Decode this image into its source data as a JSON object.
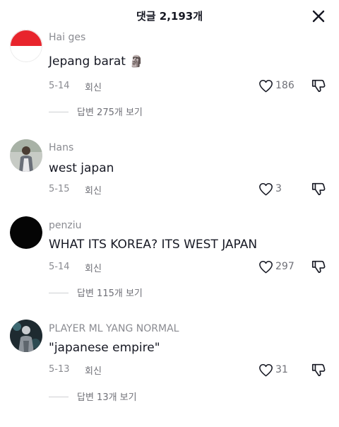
{
  "header": {
    "title": "댓글 2,193개"
  },
  "comments": [
    {
      "username": "Hai ges",
      "text": "Jepang barat",
      "emoji": "🗿",
      "date": "5-14",
      "reply_label": "회신",
      "likes": "186",
      "view_replies": "답변 275개 보기"
    },
    {
      "username": "Hans",
      "text": "west japan",
      "date": "5-15",
      "reply_label": "회신",
      "likes": "3"
    },
    {
      "username": "penziu",
      "text": "WHAT ITS KOREA? ITS WEST JAPAN",
      "date": "5-14",
      "reply_label": "회신",
      "likes": "297",
      "view_replies": "답변 115개 보기"
    },
    {
      "username": "PLAYER ML YANG NORMAL",
      "text": "\"japanese empire\"",
      "date": "5-13",
      "reply_label": "회신",
      "likes": "31",
      "view_replies": "답변 13개 보기"
    }
  ],
  "colors": {
    "text": "#161823",
    "secondary": "#8a8b91",
    "flag_red": "#e8242c"
  }
}
